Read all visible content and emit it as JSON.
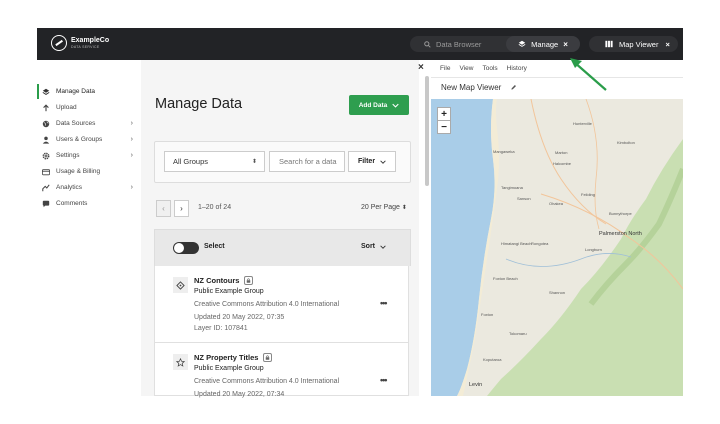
{
  "brand": {
    "name": "ExampleCo",
    "tagline": "DATA SERVICE"
  },
  "tabs": {
    "data_browser": "Data Browser",
    "manage": "Manage",
    "map_viewer": "Map Viewer",
    "close_glyph": "×"
  },
  "sidebar": {
    "items": [
      {
        "label": "Manage Data",
        "icon": "layers-icon",
        "active": true
      },
      {
        "label": "Upload",
        "icon": "upload-arrow-icon"
      },
      {
        "label": "Data Sources",
        "icon": "globe-icon",
        "chevron": true
      },
      {
        "label": "Users & Groups",
        "icon": "user-icon",
        "chevron": true
      },
      {
        "label": "Settings",
        "icon": "gear-icon",
        "chevron": true
      },
      {
        "label": "Usage & Billing",
        "icon": "card-icon"
      },
      {
        "label": "Analytics",
        "icon": "chart-icon",
        "chevron": true
      },
      {
        "label": "Comments",
        "icon": "comment-icon"
      }
    ]
  },
  "main": {
    "title": "Manage Data",
    "add_button": "Add Data",
    "group_select": "All Groups",
    "search_placeholder": "Search for a data",
    "filter_label": "Filter",
    "pager_text": "1–20 of 24",
    "per_page": "20 Per Page",
    "select_label": "Select",
    "sort_label": "Sort",
    "rows": [
      {
        "name": "NZ Contours",
        "group": "Public Example Group",
        "license": "Creative Commons Attribution 4.0 International",
        "updated": "Updated 20 May 2022, 07:35",
        "layer_id": "Layer ID: 107841",
        "more": "•••"
      },
      {
        "name": "NZ Property Titles",
        "group": "Public Example Group",
        "license": "Creative Commons Attribution 4.0 International",
        "updated": "Updated 20 May 2022, 07:34",
        "more": "•••"
      }
    ]
  },
  "map_panel": {
    "menu": [
      "File",
      "View",
      "Tools",
      "History"
    ],
    "title": "New Map Viewer",
    "zoom_in": "+",
    "zoom_out": "−",
    "places": {
      "palmerston_north": "Palmerston North",
      "foxton": "Foxton",
      "levin": "Levin",
      "shannon": "Shannon",
      "feilding": "Feilding",
      "bulls": "Bulls",
      "sanson": "Sanson",
      "halcombe": "Halcombe",
      "ashhurst": "Ashhurst",
      "pahiatua": "Pahiatua",
      "eketahuna": "Eketahuna",
      "otaki": "Otaki",
      "waikanae": "Waikanae",
      "tokomaru": "Tokomaru",
      "himatangi": "Himatangi Beach",
      "woodville": "Woodville",
      "dannevirke": "Dannevirke",
      "kimbolton": "Kimbolton",
      "apiti": "Apiti",
      "rongotea": "Rongotea",
      "tangimoana": "Tangimoana",
      "bunnythorpe": "Bunnythorpe",
      "longburn": "Longburn",
      "koputaroa": "Koputaroa",
      "ohau": "Ohau",
      "manakau": "Manakau",
      "te_horo": "Te Horo",
      "foxton_beach": "Foxton Beach",
      "mangaweka": "Mangaweka",
      "hunterville": "Hunterville",
      "marton": "Marton",
      "ohakea": "Ohakea",
      "mangaone": "Mangaone"
    }
  },
  "colors": {
    "topbar": "#222326",
    "accent_green": "#2e9e4f",
    "sea": "#a9cde8",
    "land": "#ebe9df",
    "forest": "#c9dfb2"
  }
}
